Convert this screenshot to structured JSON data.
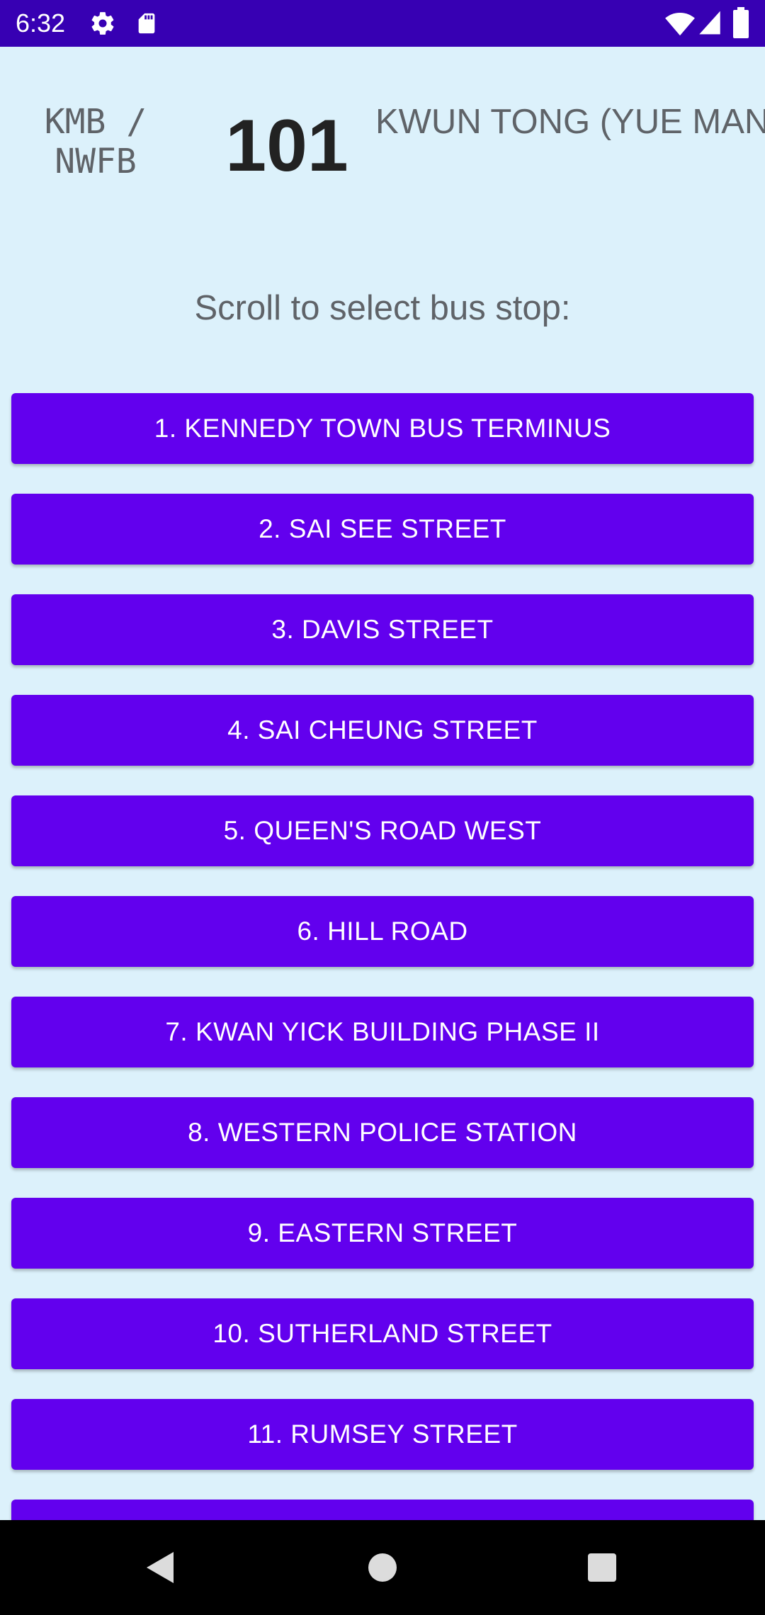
{
  "status_bar": {
    "time": "6:32",
    "icons": [
      "gear-icon",
      "sd-card-icon",
      "wifi-icon",
      "signal-icon",
      "battery-icon"
    ]
  },
  "header": {
    "company": "KMB /\nNWFB",
    "route": "101",
    "destination": "KWUN TONG (YUE MAN SQUARE)"
  },
  "prompt": "Scroll to select bus stop:",
  "stops": [
    "1. KENNEDY TOWN BUS TERMINUS",
    "2. SAI SEE STREET",
    "3. DAVIS STREET",
    "4. SAI CHEUNG STREET",
    "5. QUEEN'S ROAD WEST",
    "6. HILL ROAD",
    "7. KWAN YICK BUILDING PHASE II",
    "8. WESTERN POLICE STATION",
    "9. EASTERN STREET",
    "10. SUTHERLAND STREET",
    "11. RUMSEY STREET",
    ""
  ],
  "nav_bar": {
    "icons": [
      "back-icon",
      "home-icon",
      "recents-icon"
    ]
  },
  "colors": {
    "status_bar": "#3700b3",
    "background": "#dcf1fb",
    "button": "#6200ee",
    "button_text": "#ffffff"
  }
}
